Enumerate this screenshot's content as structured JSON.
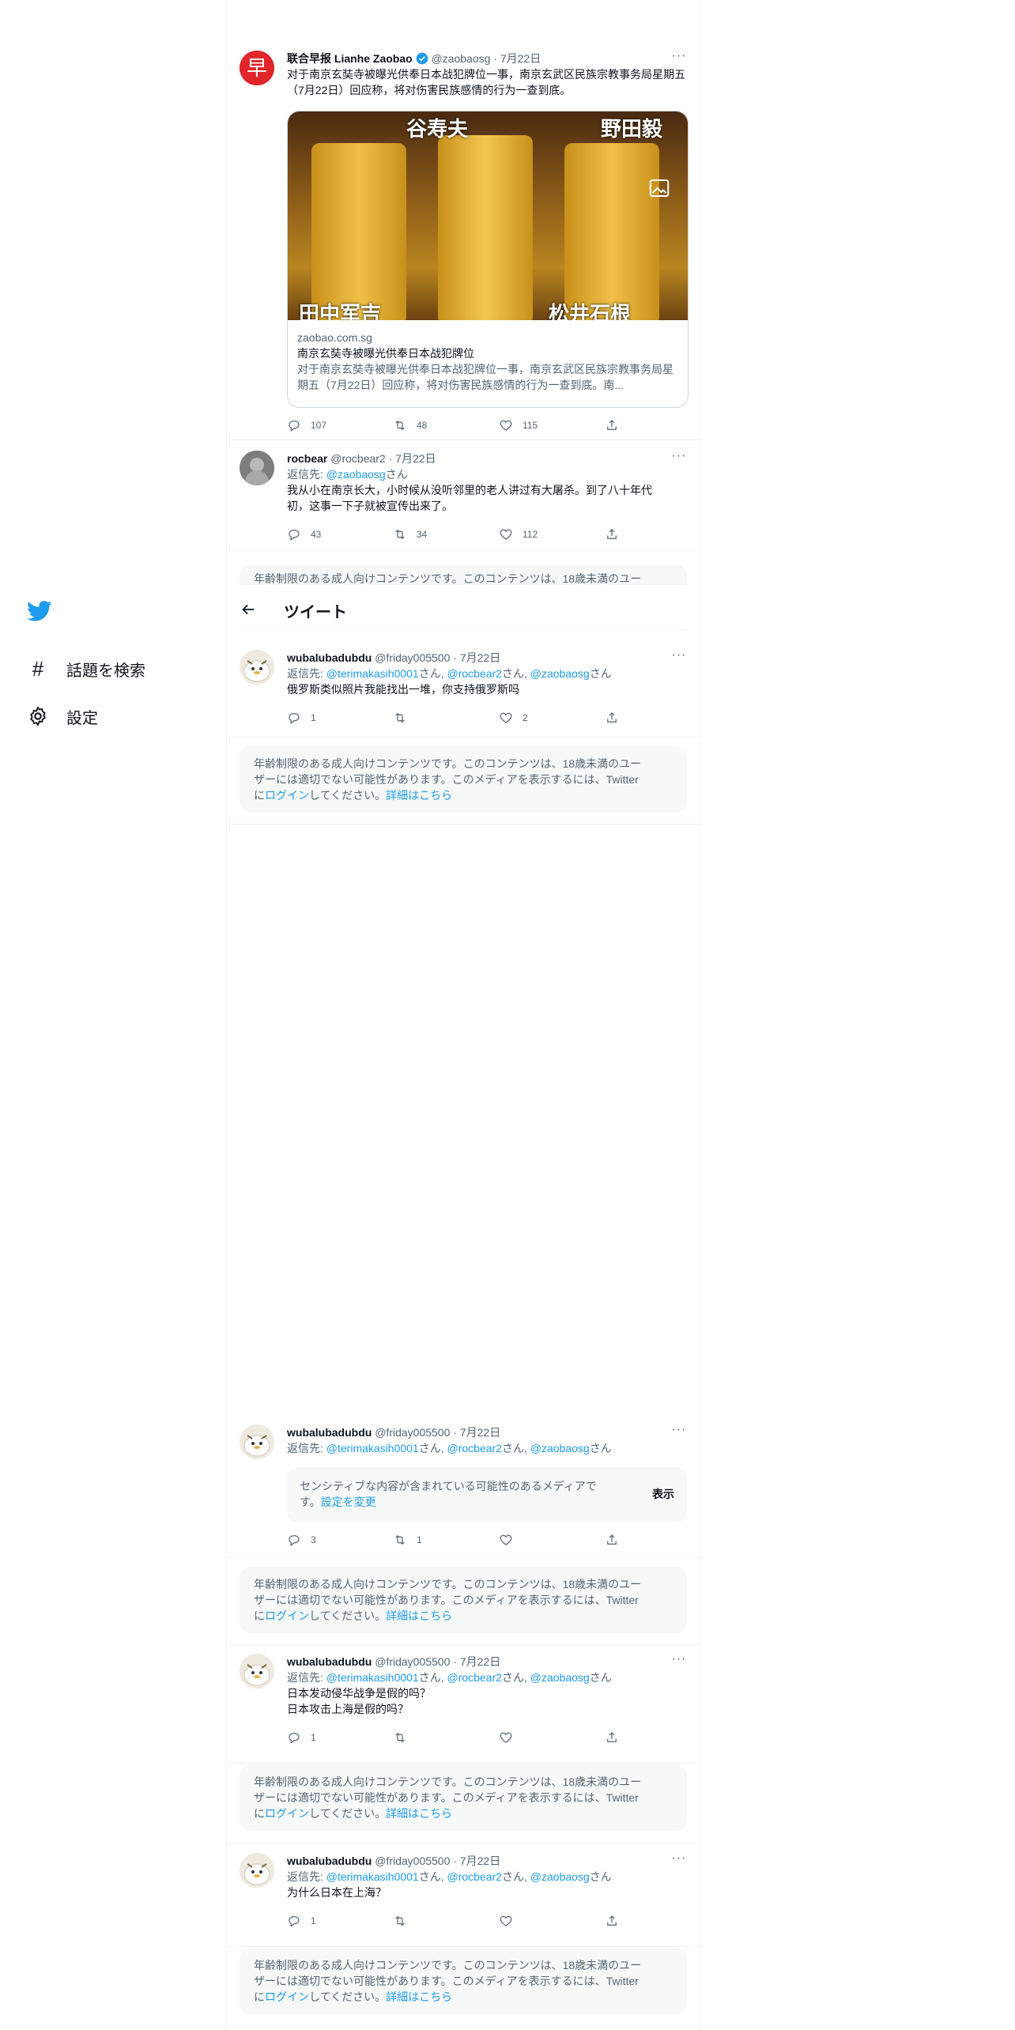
{
  "sidebar": {
    "logo_icon": "twitter-bird-icon",
    "items": [
      {
        "label": "話題を検索",
        "icon": "hashtag-icon"
      },
      {
        "label": "設定",
        "icon": "gear-icon"
      }
    ]
  },
  "header": {
    "back_icon": "back-arrow-icon",
    "title": "ツイート"
  },
  "tweets": [
    {
      "name": "联合早报 Lianhe Zaobao",
      "handle": "@zaobaosg",
      "date": "7月22日",
      "verified": true,
      "text": "对于南京玄奘寺被曝光供奉日本战犯牌位一事，南京玄武区民族宗教事务局星期五（7月22日）回应称，将对伤害民族感情的行为一查到底。",
      "card": {
        "domain": "zaobao.com.sg",
        "title": "南京玄奘寺被曝光供奉日本战犯牌位",
        "desc": "对于南京玄奘寺被曝光供奉日本战犯牌位一事，南京玄武区民族宗教事务局星期五（7月22日）回应称，将对伤害民族感情的行为一查到底。南...",
        "image_labels": [
          "谷寿夫",
          "野田毅",
          "田中军吉",
          "松井石根"
        ]
      },
      "replies": "107",
      "retweets": "48",
      "likes": "115"
    },
    {
      "name": "rocbear",
      "handle": "@rocbear2",
      "date": "7月22日",
      "reply_prefix": "返信先: ",
      "reply_to": "@zaobaosg",
      "reply_suffix": "さん",
      "text_lines": [
        "我从小在南京长大，小时候从没听邻里的老人讲过有大屠杀。到了八十年代",
        "初，这事一下子就被宣传出来了。"
      ],
      "replies": "43",
      "retweets": "34",
      "likes": "112"
    },
    {
      "name": "wubalubadubdu",
      "handle": "@friday005500",
      "date": "7月22日",
      "reply_to_users": [
        "@terimakasih0001",
        "@rocbear2",
        "@zaobaosg"
      ],
      "text": "俄罗斯类似照片我能找出一堆，你支持俄罗斯吗",
      "replies": "1",
      "retweets": "",
      "likes": "2"
    },
    {
      "name": "wubalubadubdu",
      "handle": "@friday005500",
      "date": "7月22日",
      "reply_to_users": [
        "@terimakasih0001",
        "@rocbear2",
        "@zaobaosg"
      ],
      "sensitive_text": "センシティブな内容が含まれている可能性のあるメディアで",
      "sensitive_text2": "す。",
      "sensitive_link": "設定を変更",
      "show_label": "表示",
      "replies": "3",
      "retweets": "1",
      "likes": ""
    },
    {
      "name": "wubalubadubdu",
      "handle": "@friday005500",
      "date": "7月22日",
      "reply_to_users": [
        "@terimakasih0001",
        "@rocbear2",
        "@zaobaosg"
      ],
      "text_lines": [
        "日本发动侵华战争是假的吗？",
        "日本攻击上海是假的吗？"
      ],
      "replies": "1",
      "retweets": "",
      "likes": ""
    },
    {
      "name": "wubalubadubdu",
      "handle": "@friday005500",
      "date": "7月22日",
      "reply_to_users": [
        "@terimakasih0001",
        "@rocbear2",
        "@zaobaosg"
      ],
      "text": "为什么日本在上海？",
      "replies": "1",
      "retweets": "",
      "likes": ""
    }
  ],
  "age_notice": {
    "line1": "年齢制限のある成人向けコンテンツです。このコンテンツは、18歳未満のユー",
    "line2": "ザーには適切でない可能性があります。このメディアを表示するには、Twitter",
    "line3_prefix": "に",
    "login_link": "ログイン",
    "line3_mid": "してください。",
    "details_link": "詳細はこちら"
  },
  "reply_prefix": "返信先: ",
  "san": "さん",
  "sep": ", ",
  "colors": {
    "accent": "#1d9bf0",
    "text": "#0f1419",
    "muted": "#536471"
  }
}
